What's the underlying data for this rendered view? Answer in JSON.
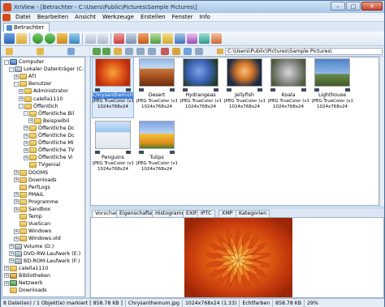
{
  "window": {
    "title": "XnView - [Betrachter - C:\\Users\\Public\\Pictures\\Sample Pictures\\]"
  },
  "menu": [
    "Datei",
    "Bearbeiten",
    "Ansicht",
    "Werkzeuge",
    "Erstellen",
    "Fenster",
    "Info"
  ],
  "tab": {
    "label": "Betrachter"
  },
  "address": {
    "path": "C:\\Users\\Public\\Pictures\\Sample Pictures\\"
  },
  "tree": [
    {
      "label": "Computer",
      "icon": "computer"
    },
    {
      "label": "Lokaler Datenträger (C:)",
      "icon": "drive"
    },
    {
      "label": "ATI",
      "icon": "folder"
    },
    {
      "label": "Benutzer",
      "icon": "folder"
    },
    {
      "label": "Administrator",
      "icon": "folder"
    },
    {
      "label": "calella1110",
      "icon": "folder"
    },
    {
      "label": "Öffentlich",
      "icon": "folder"
    },
    {
      "label": "Öffentliche Bil",
      "icon": "folder"
    },
    {
      "label": "Beispielbil",
      "icon": "folder"
    },
    {
      "label": "Öffentliche Dc",
      "icon": "folder"
    },
    {
      "label": "Öffentliche Dc",
      "icon": "folder"
    },
    {
      "label": "Öffentliche Mi",
      "icon": "folder"
    },
    {
      "label": "Öffentliche TV",
      "icon": "folder"
    },
    {
      "label": "Öffentliche Vi",
      "icon": "folder"
    },
    {
      "label": "TVgenial",
      "icon": "folder"
    },
    {
      "label": "DOOMS",
      "icon": "folder"
    },
    {
      "label": "Downloads",
      "icon": "folder"
    },
    {
      "label": "PerfLogs",
      "icon": "folder"
    },
    {
      "label": "PMAIL",
      "icon": "folder"
    },
    {
      "label": "Programme",
      "icon": "folder"
    },
    {
      "label": "Sandbox",
      "icon": "folder"
    },
    {
      "label": "Temp",
      "icon": "folder"
    },
    {
      "label": "VueScan",
      "icon": "folder"
    },
    {
      "label": "Windows",
      "icon": "folder"
    },
    {
      "label": "Windows.old",
      "icon": "folder"
    },
    {
      "label": "Volume (D:)",
      "icon": "drive"
    },
    {
      "label": "DVD-RW-Laufwerk (E:)",
      "icon": "drive"
    },
    {
      "label": "BD-ROM-Laufwerk (F:)",
      "icon": "drive"
    },
    {
      "label": "calella1110",
      "icon": "folder"
    },
    {
      "label": "Bibliotheken",
      "icon": "lib"
    },
    {
      "label": "Netzwerk",
      "icon": "net"
    },
    {
      "label": "Downloads",
      "icon": "folder"
    }
  ],
  "thumbnails": [
    {
      "name": "Chrysanthemum",
      "format": "JPEG TrueColor (v1.1)",
      "dims": "1024x768x24",
      "selected": true
    },
    {
      "name": "Desert",
      "format": "JPEG TrueColor (v1.1)",
      "dims": "1024x768x24",
      "selected": false
    },
    {
      "name": "Hydrangeas",
      "format": "JPEG TrueColor (v1.1)",
      "dims": "1024x768x24",
      "selected": false
    },
    {
      "name": "Jellyfish",
      "format": "JPEG TrueColor (v1.1)",
      "dims": "1024x768x24",
      "selected": false
    },
    {
      "name": "Koala",
      "format": "JPEG TrueColor (v1.1)",
      "dims": "1024x768x24",
      "selected": false
    },
    {
      "name": "Lighthouse",
      "format": "JPEG TrueColor (v1.1)",
      "dims": "1024x768x24",
      "selected": false
    },
    {
      "name": "Penguins",
      "format": "JPEG TrueColor (v1.1)",
      "dims": "1024x768x24",
      "selected": false
    },
    {
      "name": "Tulips",
      "format": "JPEG TrueColor (v1.1)",
      "dims": "1024x768x24",
      "selected": false
    }
  ],
  "panel_tabs": [
    "Vorschau",
    "Eigenschaften",
    "Histogramm",
    "EXIF",
    "IPTC",
    "XMP",
    "Kategorien"
  ],
  "status": {
    "count": "8 Datei(en) / 1 Objekt(e) markiert  [ 858.78 KB ]",
    "filename": "Chrysanthemum.jpg",
    "dims": "1024x768x24 (1.33)",
    "color": "Echtfarben",
    "size": "858.78 KB",
    "zoom": "29%"
  }
}
